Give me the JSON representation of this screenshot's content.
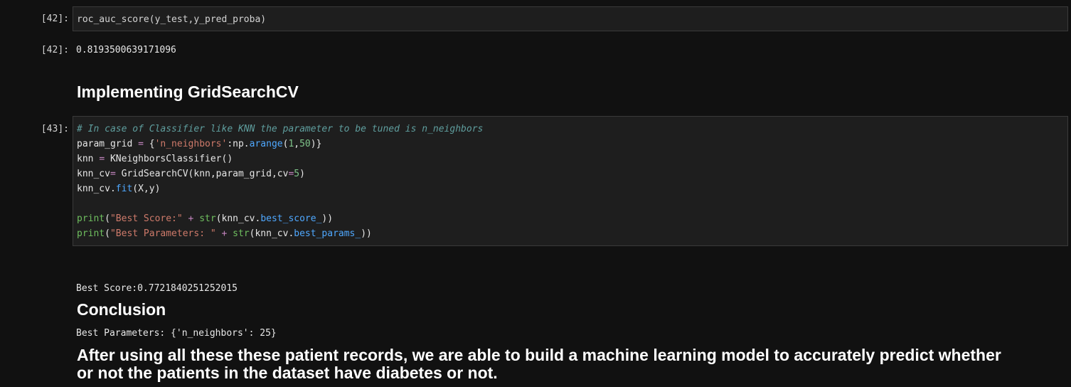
{
  "cells": [
    {
      "prompt_in": "[42]:",
      "code": "roc_auc_score(y_test,y_pred_proba)",
      "prompt_out": "[42]:",
      "output": "0.8193500639171096"
    },
    {
      "heading": "Implementing GridSearchCV"
    },
    {
      "prompt_in": "[43]:",
      "code_lines": {
        "l1_comment": "# In case of Classifier like KNN the parameter to be tuned is n_neighbors",
        "l2_a": "param_grid ",
        "l2_eq": "=",
        "l2_b": " {",
        "l2_str": "'n_neighbors'",
        "l2_c": ":np.",
        "l2_attr": "arange",
        "l2_d": "(",
        "l2_n1": "1",
        "l2_e": ",",
        "l2_n2": "50",
        "l2_f": ")}",
        "l3_a": "knn ",
        "l3_eq": "=",
        "l3_b": " KNeighborsClassifier()",
        "l4_a": "knn_cv",
        "l4_eq": "=",
        "l4_b": " GridSearchCV(knn,param_grid,cv",
        "l4_eq2": "=",
        "l4_n": "5",
        "l4_c": ")",
        "l5_a": "knn_cv.",
        "l5_attr": "fit",
        "l5_b": "(X,y)",
        "l7_print": "print",
        "l7_a": "(",
        "l7_str": "\"Best Score:\"",
        "l7_plus": " + ",
        "l7_str_fn": "str",
        "l7_b": "(knn_cv.",
        "l7_attr": "best_score_",
        "l7_c": "))",
        "l8_print": "print",
        "l8_a": "(",
        "l8_str": "\"Best Parameters: \"",
        "l8_plus": " + ",
        "l8_str_fn": "str",
        "l8_b": "(knn_cv.",
        "l8_attr": "best_params_",
        "l8_c": "))"
      },
      "output_lines": [
        "Best Score:0.7721840251252015",
        "Best Parameters: {'n_neighbors': 25}"
      ]
    },
    {
      "heading": "Conclusion"
    },
    {
      "paragraph_line1": "After using all these these patient records, we are able to build a machine learning model to accurately predict whether",
      "paragraph_line2": "or not the patients in the dataset have diabetes or not."
    }
  ],
  "colors": {
    "background": "#111111",
    "cell_background": "#1e1e1e",
    "comment": "#5f9e9e",
    "string": "#ce7a6a",
    "number": "#7fc48a",
    "operator": "#c586c0",
    "builtin": "#6fbf5f",
    "attribute": "#4fa8ff"
  }
}
